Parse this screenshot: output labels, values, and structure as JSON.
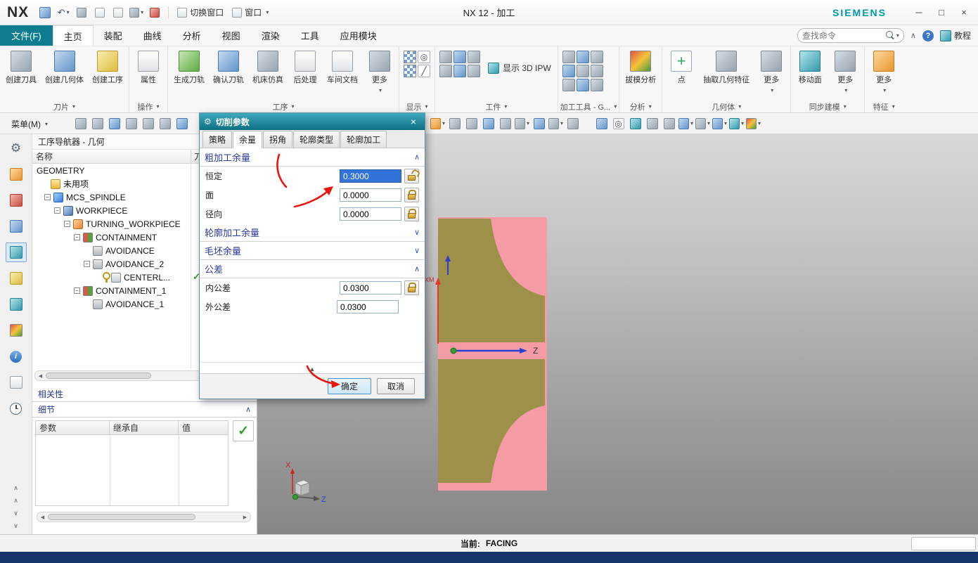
{
  "titlebar": {
    "logo": "NX",
    "title": "NX 12 - 加工",
    "brand": "SIEMENS",
    "switch_window": "切换窗口",
    "window_menu": "窗口"
  },
  "tabs": {
    "file": "文件(F)",
    "items": [
      "主页",
      "装配",
      "曲线",
      "分析",
      "视图",
      "渲染",
      "工具",
      "应用模块"
    ],
    "search_placeholder": "查找命令",
    "tutorial": "教程"
  },
  "ribbon": {
    "g1": {
      "label": "刀片",
      "b1": "创建刀具",
      "b2": "创建几何体",
      "b3": "创建工序"
    },
    "g2": {
      "label": "操作",
      "b1": "属性"
    },
    "g3": {
      "label": "工序",
      "b1": "生成刀轨",
      "b2": "确认刀轨",
      "b3": "机床仿真",
      "b4": "后处理",
      "b5": "车间文档",
      "b6": "更多"
    },
    "g4": {
      "label": "显示"
    },
    "g5": {
      "label": "工件",
      "b1": "显示 3D IPW"
    },
    "g6": {
      "label": "加工工具 - G..."
    },
    "g7": {
      "label": "分析",
      "b1": "拔模分析"
    },
    "g8": {
      "label": "几何体",
      "b1": "点",
      "b2": "抽取几何特征",
      "b3": "更多"
    },
    "g9": {
      "label": "同步建模",
      "b1": "移动面",
      "b2": "更多"
    },
    "g10": {
      "label": "特征",
      "b1": "更多"
    }
  },
  "toolbar2": {
    "menu": "菜单(M)"
  },
  "navigator": {
    "title": "工序导航器 - 几何",
    "col_name": "名称",
    "col_tool": "刀",
    "rows": [
      "GEOMETRY",
      "未用项",
      "MCS_SPINDLE",
      "WORKPIECE",
      "TURNING_WORKPIECE",
      "CONTAINMENT",
      "AVOIDANCE",
      "AVOIDANCE_2",
      "CENTERL...",
      "CONTAINMENT_1",
      "AVOIDANCE_1"
    ],
    "dependencies": "相关性",
    "details": "细节",
    "dcol1": "参数",
    "dcol2": "继承自",
    "dcol3": "值"
  },
  "dialog": {
    "title": "切削参数",
    "tab1": "策略",
    "tab2": "余量",
    "tab3": "拐角",
    "tab4": "轮廓类型",
    "tab5": "轮廓加工",
    "sec1": "粗加工余量",
    "row1_label": "恒定",
    "row1_value": "0.3000",
    "row2_label": "面",
    "row2_value": "0.0000",
    "row3_label": "径向",
    "row3_value": "0.0000",
    "sec2": "轮廓加工余量",
    "sec3": "毛坯余量",
    "sec4": "公差",
    "row4_label": "内公差",
    "row4_value": "0.0300",
    "row5_label": "外公差",
    "row5_value": "0.0300",
    "ok": "确定",
    "cancel": "取消"
  },
  "graphics": {
    "label_xm": "XM",
    "label_z": "Z",
    "triad_x": "X",
    "triad_z": "Z"
  },
  "statusbar": {
    "prefix": "当前:",
    "value": "FACING"
  },
  "icons": {
    "dropdown": "▾",
    "minimize": "─",
    "maximize": "□",
    "close": "×",
    "help": "?",
    "check": "✓",
    "chevron_up": "∧",
    "chevron_down": "∨",
    "collapse": "▲",
    "left": "◀",
    "right": "▶",
    "undo": "↶",
    "redo": "↷",
    "plus": "+",
    "target": "◎",
    "slash": "╱",
    "info": "i",
    "gear": "⚙",
    "minus": "−"
  }
}
